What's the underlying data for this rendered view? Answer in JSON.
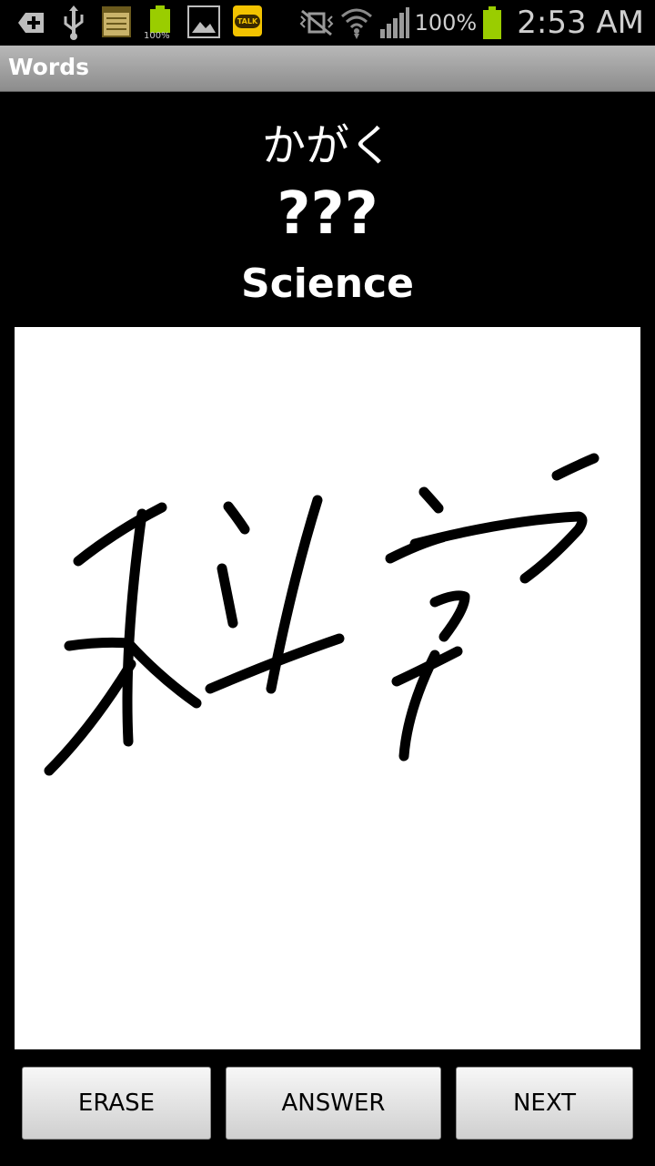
{
  "status_bar": {
    "battery_percent": "100%",
    "battery_icon_label": "100%",
    "time": "2:53 AM",
    "icons": [
      "add-icon",
      "usb-icon",
      "notes-icon",
      "battery-full-icon",
      "gallery-icon",
      "talk-icon",
      "mute-vibrate-icon",
      "wifi-icon",
      "signal-icon",
      "battery-icon"
    ],
    "talk_label": "TALK"
  },
  "app": {
    "title": "Words"
  },
  "quiz": {
    "reading": "かがく",
    "kanji_hidden": "???",
    "meaning": "Science"
  },
  "buttons": {
    "erase": "ERASE",
    "answer": "ANSWER",
    "next": "NEXT"
  },
  "colors": {
    "battery_green": "#9acd00",
    "talk_yellow": "#f3c300",
    "canvas_bg": "#ffffff",
    "ink": "#000000"
  }
}
